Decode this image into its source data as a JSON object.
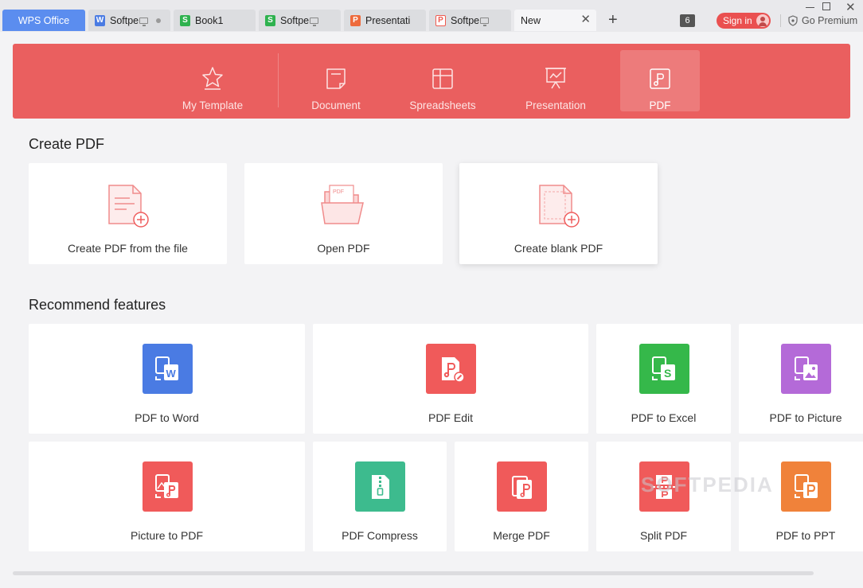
{
  "tabs": [
    {
      "label": "WPS Office",
      "type": "home"
    },
    {
      "label": "Softpe",
      "type": "word"
    },
    {
      "label": "Book1",
      "type": "sheet"
    },
    {
      "label": "Softpe",
      "type": "sheet"
    },
    {
      "label": "Presentati",
      "type": "ppt"
    },
    {
      "label": "Softpe",
      "type": "pdf"
    },
    {
      "label": "New",
      "type": "new"
    }
  ],
  "titlebar": {
    "window_count": "6",
    "signin_label": "Sign in",
    "premium_label": "Go Premium"
  },
  "categories": [
    {
      "label": "My Template",
      "icon": "star-icon"
    },
    {
      "label": "Document",
      "icon": "document-icon"
    },
    {
      "label": "Spreadsheets",
      "icon": "spreadsheet-icon"
    },
    {
      "label": "Presentation",
      "icon": "presentation-icon"
    },
    {
      "label": "PDF",
      "icon": "pdf-icon",
      "active": true
    }
  ],
  "create_section": {
    "title": "Create PDF",
    "cards": [
      {
        "label": "Create PDF from the file",
        "icon": "file-add-icon"
      },
      {
        "label": "Open PDF",
        "icon": "folder-pdf-icon"
      },
      {
        "label": "Create blank PDF",
        "icon": "blank-file-add-icon"
      }
    ]
  },
  "features_section": {
    "title": "Recommend features",
    "items": [
      {
        "label": "PDF to Word",
        "color": "#4a7be3"
      },
      {
        "label": "PDF Edit",
        "color": "#f05a5a"
      },
      {
        "label": "PDF to Excel",
        "color": "#35b84a"
      },
      {
        "label": "PDF to Picture",
        "color": "#b46ad8"
      },
      {
        "label": "Picture to PDF",
        "color": "#f05a5a"
      },
      {
        "label": "PDF Compress",
        "color": "#3dbb8e"
      },
      {
        "label": "Merge PDF",
        "color": "#f05a5a"
      },
      {
        "label": "Split PDF",
        "color": "#f05a5a"
      },
      {
        "label": "PDF to PPT",
        "color": "#f0823a"
      }
    ]
  },
  "watermark": "SOFTPEDIA"
}
